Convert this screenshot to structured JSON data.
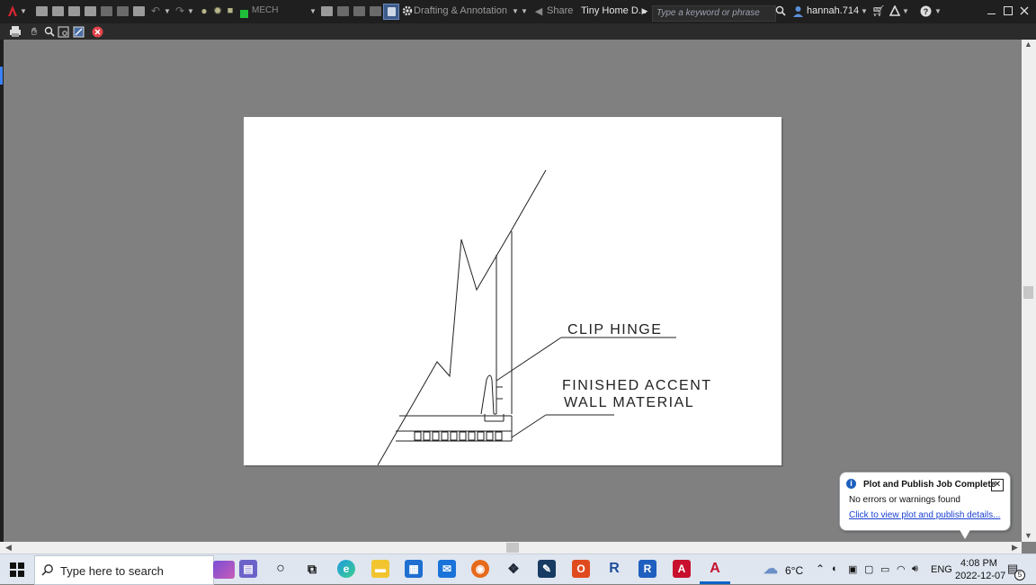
{
  "toolbar": {
    "workspace_label": "Drafting & Annotation",
    "share_label": "Share",
    "document_title": "Tiny Home D...",
    "search_placeholder": "Type a keyword or phrase",
    "user_name": "hannah.714",
    "layer_name": "MECH"
  },
  "drawing": {
    "label_clip_hinge": "CLIP HINGE",
    "label_finished_line1": "FINISHED ACCENT",
    "label_finished_line2": "WALL MATERIAL"
  },
  "notification": {
    "title": "Plot and Publish Job Complete",
    "message": "No errors or warnings found",
    "link": "Click to view plot and publish details..."
  },
  "taskbar": {
    "search_placeholder": "Type here to search",
    "weather": "6°C",
    "language": "ENG",
    "time": "4:08 PM",
    "date": "2022-12-07",
    "notification_count": "5"
  },
  "colors": {
    "accent": "#0a64c8",
    "autocad_red": "#c8102e",
    "layer_green": "#1fbf3a"
  }
}
